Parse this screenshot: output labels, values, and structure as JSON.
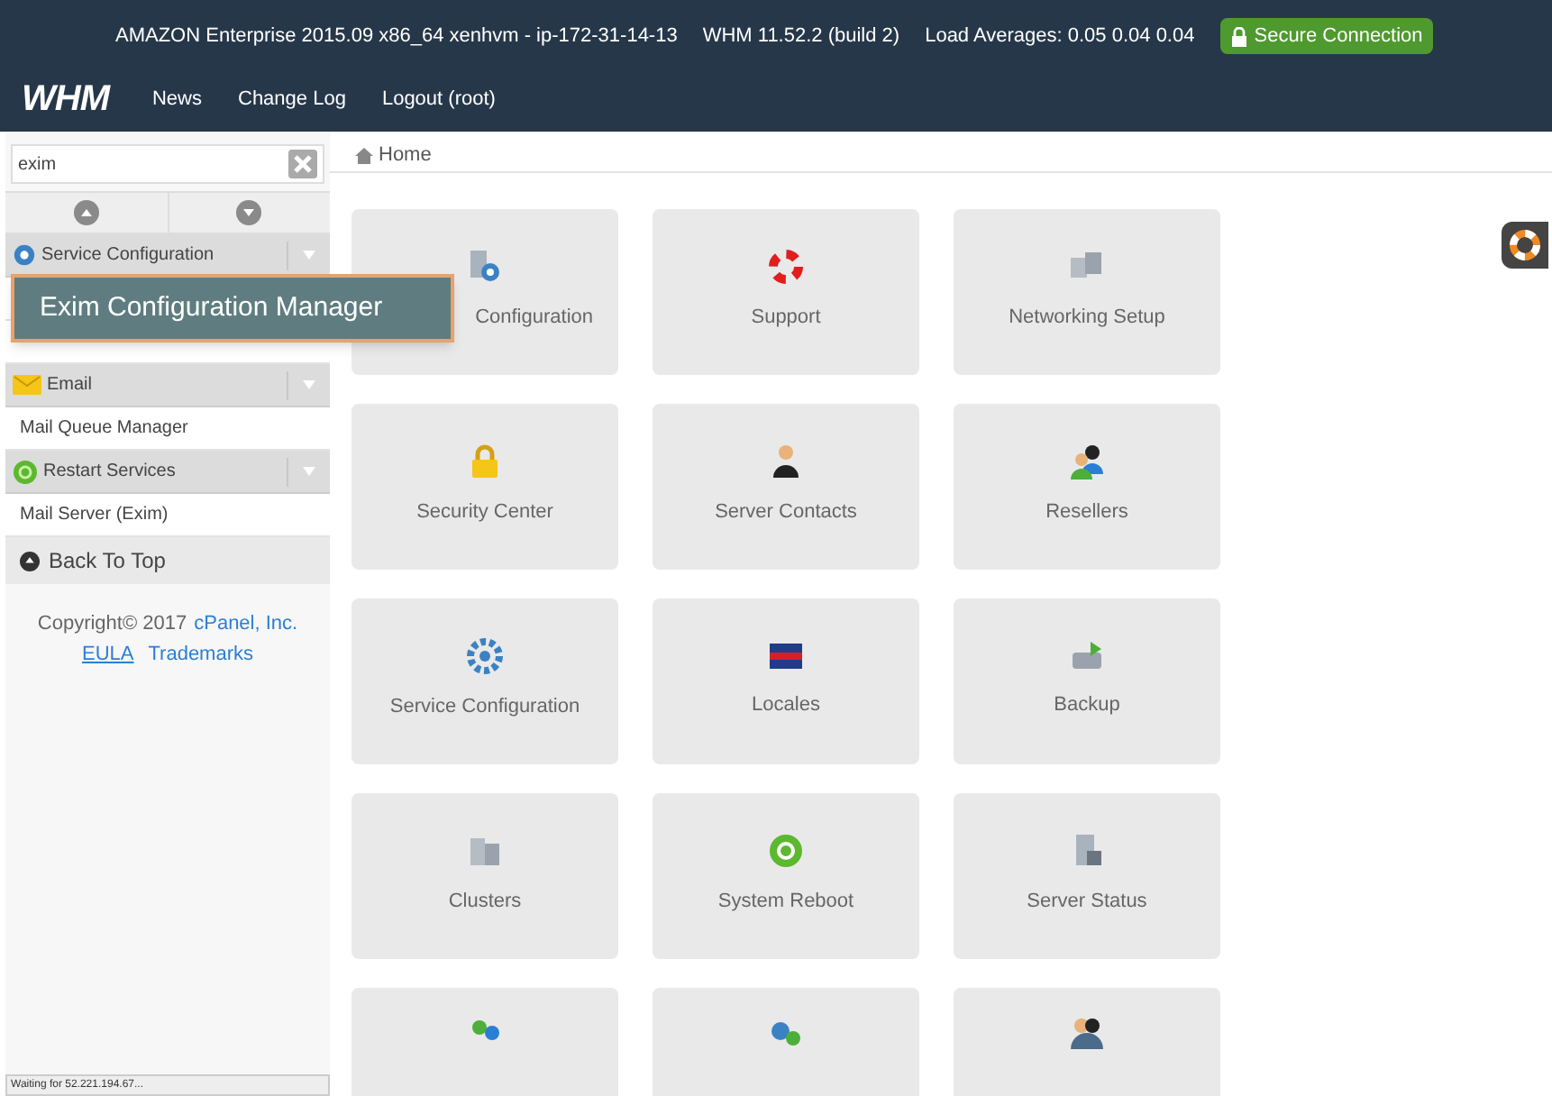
{
  "top_bar": {
    "server_info": "AMAZON Enterprise 2015.09 x86_64 xenhvm - ip-172-31-14-13",
    "version": "WHM 11.52.2 (build 2)",
    "load": "Load Averages: 0.05 0.04 0.04",
    "secure": "Secure Connection"
  },
  "nav": {
    "logo": "WHM",
    "links": [
      "News",
      "Change Log",
      "Logout (root)"
    ]
  },
  "sidebar": {
    "search": {
      "value": "exim"
    },
    "items": [
      {
        "kind": "header",
        "label": "Service Configuration"
      },
      {
        "kind": "hidden"
      },
      {
        "kind": "hidden"
      },
      {
        "kind": "header",
        "label": "Email"
      },
      {
        "kind": "item",
        "label": "Mail Queue Manager"
      },
      {
        "kind": "header",
        "label": "Restart Services"
      },
      {
        "kind": "item",
        "label": "Mail Server (Exim)"
      }
    ],
    "back_to_top": "Back To Top",
    "copyright": "Copyright© 2017",
    "company_link": "cPanel, Inc.",
    "eula": "EULA",
    "trademarks": "Trademarks"
  },
  "tooltip": "Exim Configuration Manager",
  "breadcrumb": "Home",
  "tiles": [
    {
      "label": "Configuration"
    },
    {
      "label": "Support"
    },
    {
      "label": "Networking Setup"
    },
    {
      "label": "Security Center"
    },
    {
      "label": "Server Contacts"
    },
    {
      "label": "Resellers"
    },
    {
      "label": "Service Configuration"
    },
    {
      "label": "Locales"
    },
    {
      "label": "Backup"
    },
    {
      "label": "Clusters"
    },
    {
      "label": "System Reboot"
    },
    {
      "label": "Server Status"
    },
    {
      "kind": "cut"
    },
    {
      "kind": "cut"
    },
    {
      "kind": "cut"
    }
  ],
  "status_bar": "Waiting for 52.221.194.67..."
}
